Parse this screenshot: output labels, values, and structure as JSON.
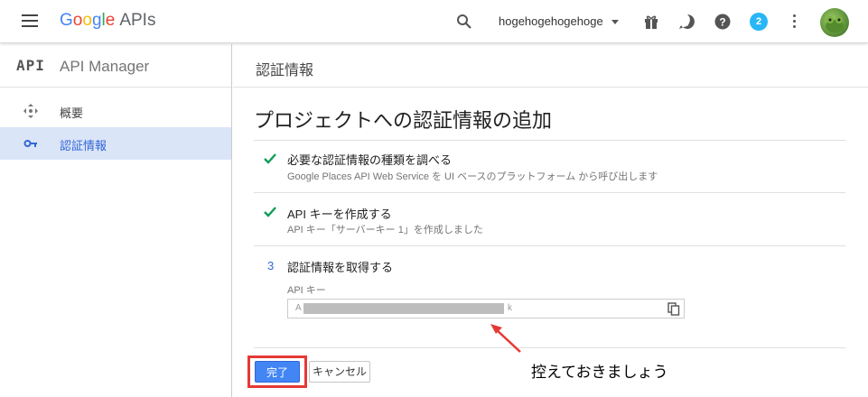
{
  "topbar": {
    "logo": {
      "letters": [
        "G",
        "o",
        "o",
        "g",
        "l",
        "e"
      ],
      "suffix": "APIs"
    },
    "project_name": "hogehogehogehoge",
    "notification_count": "2",
    "icons": [
      "menu-icon",
      "search-icon",
      "gift-icon",
      "alert-icon",
      "help-icon",
      "more-vert-icon",
      "avatar"
    ]
  },
  "sidebar": {
    "mark": "API",
    "title": "API Manager",
    "items": [
      {
        "label": "概要",
        "icon": "move-icon",
        "active": false
      },
      {
        "label": "認証情報",
        "icon": "key-icon",
        "active": true
      }
    ]
  },
  "main": {
    "header": "認証情報",
    "page_title": "プロジェクトへの認証情報の追加",
    "steps": [
      {
        "status": "done",
        "title": "必要な認証情報の種類を調べる",
        "subtitle": "Google Places API Web Service を UI ベースのプラットフォーム から呼び出します"
      },
      {
        "status": "done",
        "title": "API キーを作成する",
        "subtitle": "API キー「サーバーキー 1」を作成しました"
      },
      {
        "status": "current",
        "number": "3",
        "title": "認証情報を取得する"
      }
    ],
    "api_key": {
      "label": "API キー",
      "prefix": "A",
      "suffix": "k"
    },
    "buttons": {
      "done": "完了",
      "cancel": "キャンセル"
    },
    "annotation": "控えておきましょう"
  },
  "colors": {
    "accent": "#4285f4",
    "check": "#0f9d58",
    "highlight": "#e53935",
    "sidebar_active_bg": "#dbe5f8"
  }
}
